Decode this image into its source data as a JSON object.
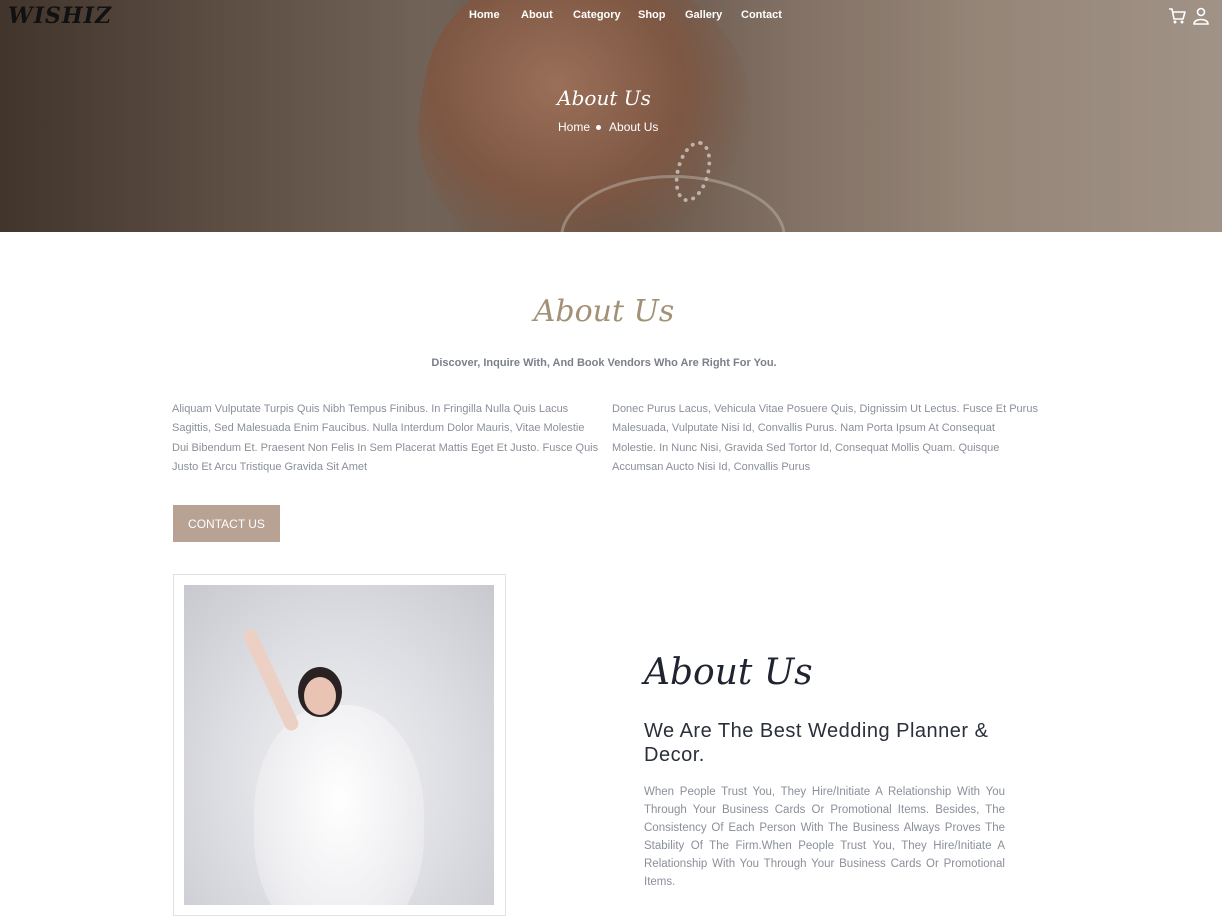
{
  "brand": {
    "logo_text": "WISHIZ"
  },
  "nav": {
    "items": [
      "Home",
      "About",
      "Category",
      "Shop",
      "Gallery",
      "Contact"
    ]
  },
  "header_icons": [
    "cart-icon",
    "user-icon"
  ],
  "hero": {
    "title": "About Us",
    "breadcrumb": [
      "Home",
      "About Us"
    ]
  },
  "about": {
    "title": "About Us",
    "subtitle": "Discover, Inquire With, And Book Vendors Who Are Right For You.",
    "para_left": "Aliquam Vulputate Turpis Quis Nibh Tempus Finibus. In Fringilla Nulla Quis Lacus Sagittis, Sed Malesuada Enim Faucibus. Nulla Interdum Dolor Mauris, Vitae Molestie Dui Bibendum Et. Praesent Non Felis In Sem Placerat Mattis Eget Et Justo. Fusce Quis Justo Et Arcu Tristique Gravida Sit Amet",
    "para_right": "Donec Purus Lacus, Vehicula Vitae Posuere Quis, Dignissim Ut Lectus. Fusce Et Purus Malesuada, Vulputate Nisi Id, Convallis Purus. Nam Porta Ipsum At Consequat Molestie. In Nunc Nisi, Gravida Sed Tortor Id, Consequat Mollis Quam. Quisque Accumsan Aucto Nisi Id, Convallis Purus",
    "button_label": "CONTACT US"
  },
  "about2": {
    "title": "About Us",
    "heading": "We Are The Best Wedding Planner & Decor.",
    "text": "When People Trust You, They Hire/Initiate A Relationship With You Through Your Business Cards Or Promotional Items. Besides, The Consistency Of Each Person With The Business Always Proves The Stability Of The Firm.When People Trust You, They Hire/Initiate A Relationship With You Through Your Business Cards Or Promotional Items."
  },
  "colors": {
    "accent": "#b8a294",
    "title_gold": "#a39176",
    "body_text": "#8a8f99"
  }
}
